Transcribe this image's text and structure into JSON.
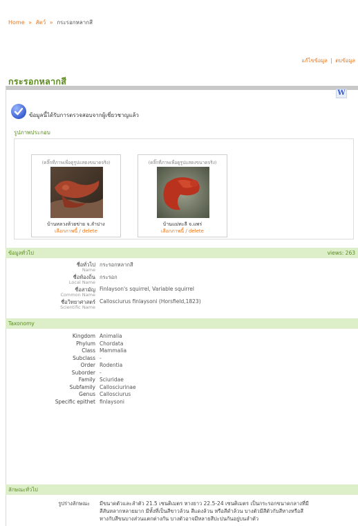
{
  "breadcrumb": {
    "home": "Home",
    "sep1": "»",
    "animals": "สัตว์",
    "sep2": "»",
    "current": "กระรอกหลากสี"
  },
  "top_links": {
    "edit": "แก้ไขข้อมูล",
    "separator": "|",
    "discuss": "ตบข้อมูล"
  },
  "page_title": "กระรอกหลากสี",
  "verified": {
    "text": "ข้อมูลนี้ได้รับการตรวจสอบจากผู้เชี่ยวชาญแล้ว",
    "icon": "checkmark-icon"
  },
  "wiki_badge": "W",
  "photos": {
    "label": "รูปภาพประกอบ",
    "items": [
      {
        "hint": "(คลิ๊กที่ภาพเพื่อดูรูปแสดงขนาดจริง)",
        "caption": "บ้านหลวงห้วยข่าย จ.ลำปาง",
        "action": "เลือกภาพนี้ / delete"
      },
      {
        "hint": "(คลิ๊กที่ภาพเพื่อดูรูปแสดงขนาดจริง)",
        "caption": "บ้านแม่ทะลี จ.แพร่",
        "action": "เลือกภาพนี้ / delete"
      }
    ]
  },
  "basic": {
    "header": "ข้อมูลทั่วไป",
    "views": "views: 263",
    "rows": [
      {
        "key": "ชื่อทั่วไป",
        "sub": "Name",
        "value": "กระรอกหลากสี"
      },
      {
        "key": "ชื่อท้องถิ่น",
        "sub": "Local Name",
        "value": "กระรอก"
      },
      {
        "key": "ชื่อสามัญ",
        "sub": "Common Name",
        "value": "Finlayson's squirrel, Variable squirrel"
      },
      {
        "key": "ชื่อวิทยาศาสตร์",
        "sub": "Scientific Name",
        "value": "Callosciurus finlaysoni (Horsfield,1823)"
      }
    ]
  },
  "taxonomy": {
    "header": "Taxonomy",
    "rows": [
      {
        "key": "Kingdom",
        "value": "Animalia"
      },
      {
        "key": "Phylum",
        "value": "Chordata"
      },
      {
        "key": "Class",
        "value": "Mammalia"
      },
      {
        "key": "Subclass",
        "value": "-"
      },
      {
        "key": "Order",
        "value": "Rodentia"
      },
      {
        "key": "Suborder",
        "value": "-"
      },
      {
        "key": "Family",
        "value": "Sciuridae"
      },
      {
        "key": "Subfamily",
        "value": "Callosciurinae"
      },
      {
        "key": "Genus",
        "value": "Callosciurus"
      },
      {
        "key": "Specific epithet",
        "value": "finlaysoni"
      }
    ]
  },
  "characteristics": {
    "header": "ลักษณะทั่วไป",
    "key": "รูปร่างลักษณะ",
    "lines": [
      "มีขนาดตัวและลำตัว 21.5 เซนติเมตร หางยาว 22.5-24 เซนติเมตร เป็นกระรอกขนาดกลางที่มี",
      "สีสันหลากหลายมาก มีทั้งที่เป็นสีขาวล้วน สีแดงล้วน หรือสีดำล้วน บางตัวมีสีตัวกับสีหางหรือสี",
      "หางกับสีขนบางส่วนแตกต่างกัน บางตัวอาจมีหลายสีปะปนกันอยู่บนลำตัว"
    ]
  }
}
